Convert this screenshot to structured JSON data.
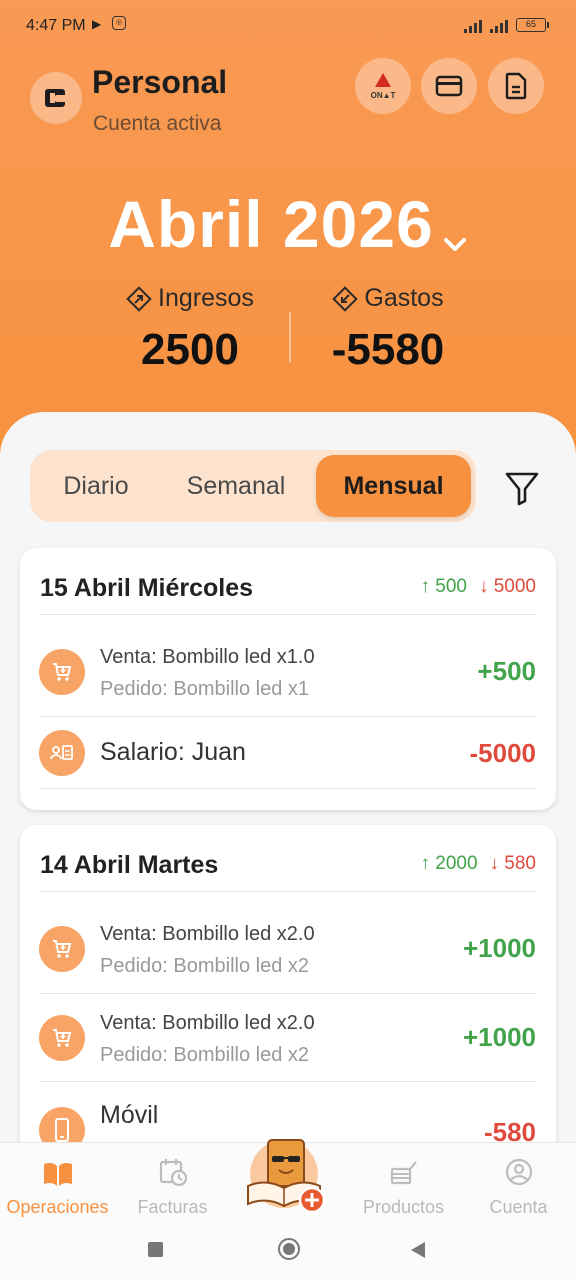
{
  "status": {
    "time": "4:47 PM",
    "battery": "65"
  },
  "account": {
    "name": "Personal",
    "subtitle": "Cuenta activa"
  },
  "header_buttons": {
    "onat_label": "ON▲T"
  },
  "period": {
    "month_label": "Abril 2026"
  },
  "summary": {
    "income_label": "Ingresos",
    "income_value": "2500",
    "expense_label": "Gastos",
    "expense_value": "-5580"
  },
  "tabs": {
    "daily": "Diario",
    "weekly": "Semanal",
    "monthly": "Mensual",
    "active": "monthly"
  },
  "days": [
    {
      "date": "15 Abril Miércoles",
      "income": "↑ 500",
      "expense": "↓ 5000",
      "transactions": [
        {
          "icon": "cart-icon",
          "title": "Venta: Bombillo led x1.0",
          "detail": "Pedido: Bombillo led x1",
          "amount": "+500"
        },
        {
          "icon": "payroll-icon",
          "title": "Salario: Juan",
          "detail": "",
          "amount": "-5000"
        }
      ]
    },
    {
      "date": "14 Abril Martes",
      "income": "↑ 2000",
      "expense": "↓ 580",
      "transactions": [
        {
          "icon": "cart-icon",
          "title": "Venta: Bombillo led x2.0",
          "detail": "Pedido: Bombillo led x2",
          "amount": "+1000"
        },
        {
          "icon": "cart-icon",
          "title": "Venta: Bombillo led x2.0",
          "detail": "Pedido: Bombillo led x2",
          "amount": "+1000"
        },
        {
          "icon": "phone-icon",
          "title": "Móvil",
          "detail": "",
          "amount": "-580"
        }
      ]
    }
  ],
  "nav": {
    "operations": "Operaciones",
    "invoices": "Facturas",
    "products": "Productos",
    "account": "Cuenta"
  },
  "colors": {
    "accent": "#f7913f",
    "income": "#41a34a",
    "expense": "#e04a3c"
  }
}
